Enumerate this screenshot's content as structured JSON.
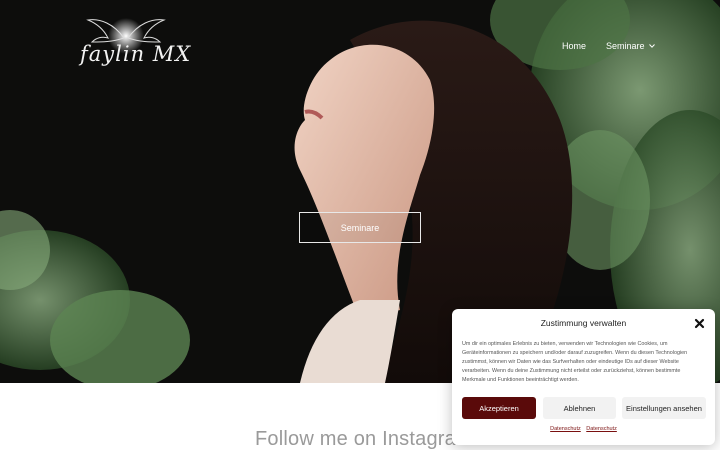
{
  "logo": {
    "text": "faylin MX"
  },
  "nav": {
    "items": [
      {
        "label": "Home"
      },
      {
        "label": "Seminare",
        "has_dropdown": true
      }
    ]
  },
  "hero": {
    "button_label": "Seminare"
  },
  "instagram": {
    "heading": "Follow me on Instagram"
  },
  "cookie_banner": {
    "title": "Zustimmung verwalten",
    "body": "Um dir ein optimales Erlebnis zu bieten, verwenden wir Technologien wie Cookies, um Geräteinformationen zu speichern und/oder darauf zuzugreifen. Wenn du diesen Technologien zustimmst, können wir Daten wie das Surfverhalten oder eindeutige IDs auf dieser Website verarbeiten. Wenn du deine Zustimmung nicht erteilst oder zurückziehst, können bestimmte Merkmale und Funktionen beeinträchtigt werden.",
    "accept_label": "Akzeptieren",
    "deny_label": "Ablehnen",
    "settings_label": "Einstellungen ansehen",
    "links": [
      "Datenschutz",
      "Datenschutz"
    ]
  },
  "colors": {
    "accent": "#5a0a0a",
    "hero_background": "#0b0b0b",
    "foliage": "#3f6a38"
  },
  "icons": [
    "logo-wings-icon",
    "chevron-down-icon",
    "close-icon"
  ]
}
